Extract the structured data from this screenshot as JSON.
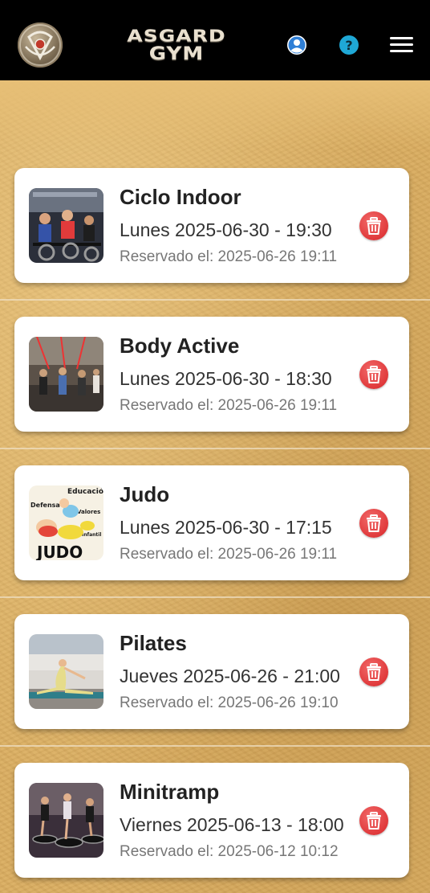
{
  "header": {
    "brand_line1": "ASGARD",
    "brand_line2": "GYM"
  },
  "bookings": [
    {
      "name": "Ciclo Indoor",
      "when": "Lunes 2025-06-30 - 19:30",
      "booked_label": "Reservado el:",
      "booked_at": "2025-06-26 19:11",
      "thumb": "ciclo-indoor-photo"
    },
    {
      "name": "Body Active",
      "when": "Lunes 2025-06-30 - 18:30",
      "booked_label": "Reservado el:",
      "booked_at": "2025-06-26 19:11",
      "thumb": "body-active-photo"
    },
    {
      "name": "Judo",
      "when": "Lunes 2025-06-30 - 17:15",
      "booked_label": "Reservado el:",
      "booked_at": "2025-06-26 19:11",
      "thumb": "judo-illustration",
      "thumb_text": {
        "educacion": "Educación",
        "defensa": "Defensa",
        "valores": "Valores",
        "infantil": "Infantil",
        "judo": "JUDO"
      }
    },
    {
      "name": "Pilates",
      "when": "Jueves 2025-06-26 - 21:00",
      "booked_label": "Reservado el:",
      "booked_at": "2025-06-26 19:10",
      "thumb": "pilates-photo"
    },
    {
      "name": "Minitramp",
      "when": "Viernes 2025-06-13 - 18:00",
      "booked_label": "Reservado el:",
      "booked_at": "2025-06-12 10:12",
      "thumb": "minitramp-photo"
    }
  ],
  "colors": {
    "header_bg": "#000000",
    "card_bg": "#ffffff",
    "delete_red": "#e0393b",
    "help_blue": "#1fa8d6",
    "profile_blue": "#2f7fd6"
  }
}
